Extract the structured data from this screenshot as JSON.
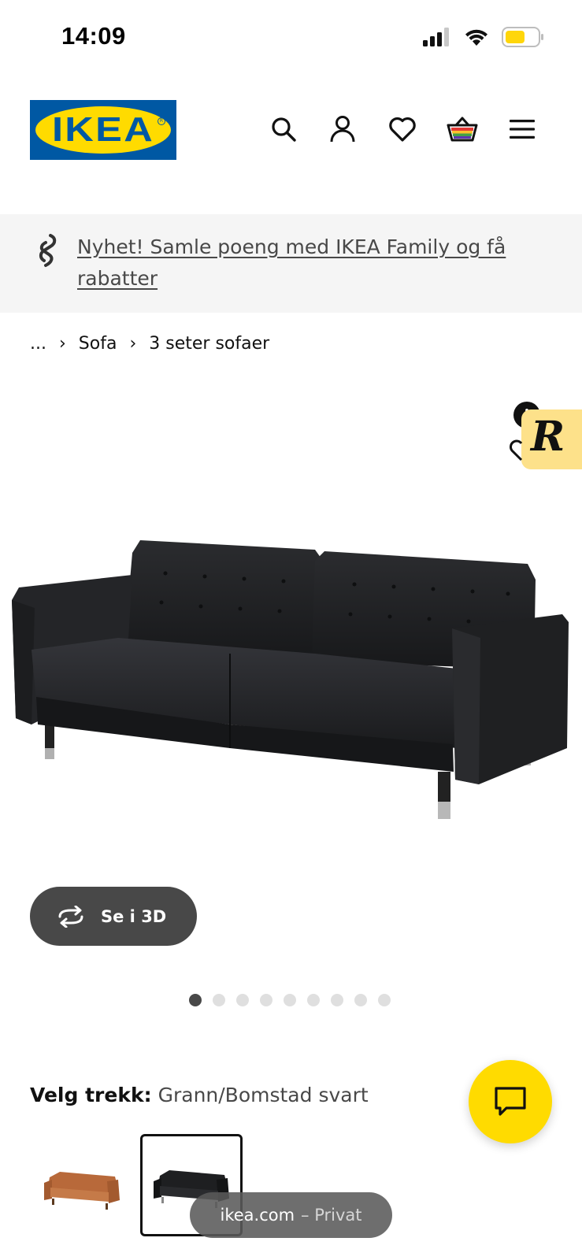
{
  "status_bar": {
    "time": "14:09",
    "icons": [
      "cellular-signal-icon",
      "wifi-icon",
      "battery-icon"
    ]
  },
  "header": {
    "logo_text": "IKEA",
    "icons": [
      "search-icon",
      "account-icon",
      "heart-icon",
      "cart-icon",
      "menu-icon"
    ]
  },
  "promo": {
    "text": "Nyhet! Samle poeng med IKEA Family og få rabatter",
    "icon": "ikea-family-icon"
  },
  "breadcrumb": {
    "items": [
      "...",
      "Sofa",
      "3 seter sofaer"
    ]
  },
  "product": {
    "image": "black-leather-sofa-image",
    "badge_letter": "R",
    "info_letter": "i",
    "view_3d_label": "Se i 3D",
    "carousel": {
      "total": 9,
      "active_index": 0
    }
  },
  "variant": {
    "label": "Velg trekk:",
    "value": "Grann/Bomstad svart",
    "swatches": [
      {
        "color": "#b8693a",
        "selected": false
      },
      {
        "color": "#1e1f21",
        "selected": true
      }
    ]
  },
  "chat": {
    "icon": "chat-icon"
  },
  "browser": {
    "domain": "ikea.com",
    "mode": "– Privat"
  },
  "colors": {
    "ikea_blue": "#0058a3",
    "ikea_yellow": "#ffdb00",
    "dark_gray": "#484848"
  }
}
